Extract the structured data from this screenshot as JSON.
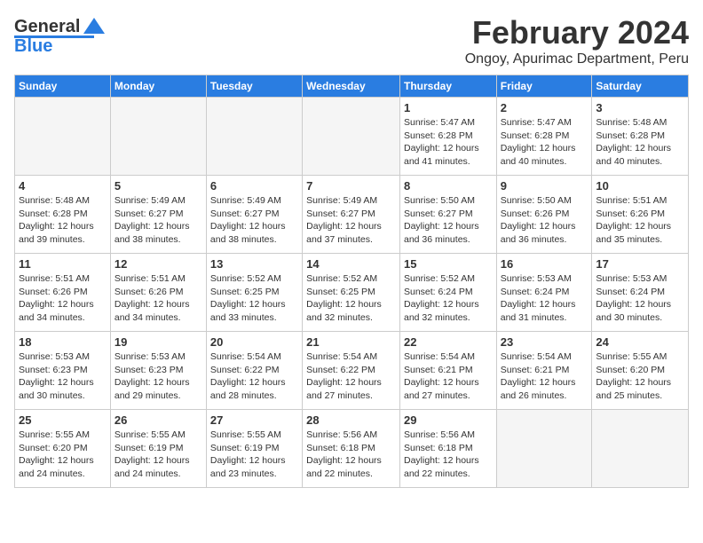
{
  "header": {
    "logo_general": "General",
    "logo_blue": "Blue",
    "title": "February 2024",
    "subtitle": "Ongoy, Apurimac Department, Peru"
  },
  "days_of_week": [
    "Sunday",
    "Monday",
    "Tuesday",
    "Wednesday",
    "Thursday",
    "Friday",
    "Saturday"
  ],
  "weeks": [
    [
      {
        "day": "",
        "info": ""
      },
      {
        "day": "",
        "info": ""
      },
      {
        "day": "",
        "info": ""
      },
      {
        "day": "",
        "info": ""
      },
      {
        "day": "1",
        "info": "Sunrise: 5:47 AM\nSunset: 6:28 PM\nDaylight: 12 hours\nand 41 minutes."
      },
      {
        "day": "2",
        "info": "Sunrise: 5:47 AM\nSunset: 6:28 PM\nDaylight: 12 hours\nand 40 minutes."
      },
      {
        "day": "3",
        "info": "Sunrise: 5:48 AM\nSunset: 6:28 PM\nDaylight: 12 hours\nand 40 minutes."
      }
    ],
    [
      {
        "day": "4",
        "info": "Sunrise: 5:48 AM\nSunset: 6:28 PM\nDaylight: 12 hours\nand 39 minutes."
      },
      {
        "day": "5",
        "info": "Sunrise: 5:49 AM\nSunset: 6:27 PM\nDaylight: 12 hours\nand 38 minutes."
      },
      {
        "day": "6",
        "info": "Sunrise: 5:49 AM\nSunset: 6:27 PM\nDaylight: 12 hours\nand 38 minutes."
      },
      {
        "day": "7",
        "info": "Sunrise: 5:49 AM\nSunset: 6:27 PM\nDaylight: 12 hours\nand 37 minutes."
      },
      {
        "day": "8",
        "info": "Sunrise: 5:50 AM\nSunset: 6:27 PM\nDaylight: 12 hours\nand 36 minutes."
      },
      {
        "day": "9",
        "info": "Sunrise: 5:50 AM\nSunset: 6:26 PM\nDaylight: 12 hours\nand 36 minutes."
      },
      {
        "day": "10",
        "info": "Sunrise: 5:51 AM\nSunset: 6:26 PM\nDaylight: 12 hours\nand 35 minutes."
      }
    ],
    [
      {
        "day": "11",
        "info": "Sunrise: 5:51 AM\nSunset: 6:26 PM\nDaylight: 12 hours\nand 34 minutes."
      },
      {
        "day": "12",
        "info": "Sunrise: 5:51 AM\nSunset: 6:26 PM\nDaylight: 12 hours\nand 34 minutes."
      },
      {
        "day": "13",
        "info": "Sunrise: 5:52 AM\nSunset: 6:25 PM\nDaylight: 12 hours\nand 33 minutes."
      },
      {
        "day": "14",
        "info": "Sunrise: 5:52 AM\nSunset: 6:25 PM\nDaylight: 12 hours\nand 32 minutes."
      },
      {
        "day": "15",
        "info": "Sunrise: 5:52 AM\nSunset: 6:24 PM\nDaylight: 12 hours\nand 32 minutes."
      },
      {
        "day": "16",
        "info": "Sunrise: 5:53 AM\nSunset: 6:24 PM\nDaylight: 12 hours\nand 31 minutes."
      },
      {
        "day": "17",
        "info": "Sunrise: 5:53 AM\nSunset: 6:24 PM\nDaylight: 12 hours\nand 30 minutes."
      }
    ],
    [
      {
        "day": "18",
        "info": "Sunrise: 5:53 AM\nSunset: 6:23 PM\nDaylight: 12 hours\nand 30 minutes."
      },
      {
        "day": "19",
        "info": "Sunrise: 5:53 AM\nSunset: 6:23 PM\nDaylight: 12 hours\nand 29 minutes."
      },
      {
        "day": "20",
        "info": "Sunrise: 5:54 AM\nSunset: 6:22 PM\nDaylight: 12 hours\nand 28 minutes."
      },
      {
        "day": "21",
        "info": "Sunrise: 5:54 AM\nSunset: 6:22 PM\nDaylight: 12 hours\nand 27 minutes."
      },
      {
        "day": "22",
        "info": "Sunrise: 5:54 AM\nSunset: 6:21 PM\nDaylight: 12 hours\nand 27 minutes."
      },
      {
        "day": "23",
        "info": "Sunrise: 5:54 AM\nSunset: 6:21 PM\nDaylight: 12 hours\nand 26 minutes."
      },
      {
        "day": "24",
        "info": "Sunrise: 5:55 AM\nSunset: 6:20 PM\nDaylight: 12 hours\nand 25 minutes."
      }
    ],
    [
      {
        "day": "25",
        "info": "Sunrise: 5:55 AM\nSunset: 6:20 PM\nDaylight: 12 hours\nand 24 minutes."
      },
      {
        "day": "26",
        "info": "Sunrise: 5:55 AM\nSunset: 6:19 PM\nDaylight: 12 hours\nand 24 minutes."
      },
      {
        "day": "27",
        "info": "Sunrise: 5:55 AM\nSunset: 6:19 PM\nDaylight: 12 hours\nand 23 minutes."
      },
      {
        "day": "28",
        "info": "Sunrise: 5:56 AM\nSunset: 6:18 PM\nDaylight: 12 hours\nand 22 minutes."
      },
      {
        "day": "29",
        "info": "Sunrise: 5:56 AM\nSunset: 6:18 PM\nDaylight: 12 hours\nand 22 minutes."
      },
      {
        "day": "",
        "info": ""
      },
      {
        "day": "",
        "info": ""
      }
    ]
  ]
}
